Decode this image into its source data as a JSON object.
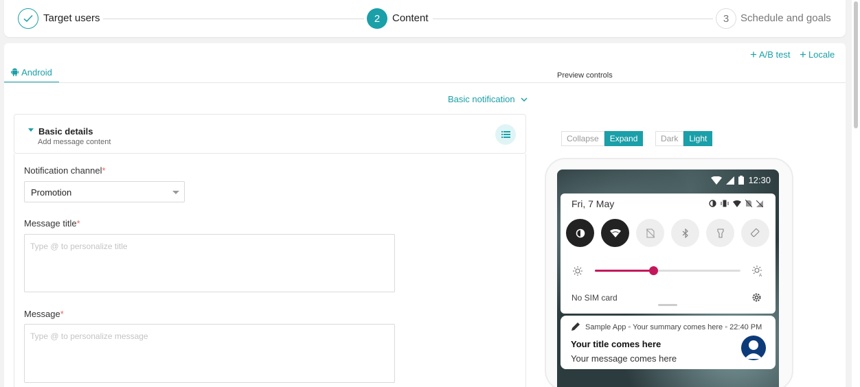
{
  "stepper": {
    "steps": [
      {
        "number": "",
        "label": "Target users",
        "state": "done",
        "icon": "check-icon"
      },
      {
        "number": "2",
        "label": "Content",
        "state": "active"
      },
      {
        "number": "3",
        "label": "Schedule and goals",
        "state": "pending"
      }
    ]
  },
  "header": {
    "ab_test": "A/B test",
    "locale": "Locale",
    "tabs": [
      {
        "label": "Android",
        "icon": "android-icon"
      }
    ]
  },
  "template_dropdown": "Basic notification",
  "basic_details": {
    "title": "Basic details",
    "subtitle": "Add message content"
  },
  "form": {
    "channel_label": "Notification channel",
    "channel_value": "Promotion",
    "title_label": "Message title",
    "title_placeholder": "Type @ to personalize title",
    "message_label": "Message",
    "message_placeholder": "Type @ to personalize message",
    "required_mark": "*"
  },
  "preview": {
    "controls_label": "Preview controls",
    "collapse": "Collapse",
    "expand": "Expand",
    "dark": "Dark",
    "light": "Light",
    "status_time": "12:30",
    "date": "Fri, 7 May",
    "brightness_level": 0.4,
    "no_sim": "No SIM card",
    "notification": {
      "meta": "Sample App ◦ Your summary comes here ◦ 22:40 PM",
      "title": "Your title comes here",
      "message": "Your message comes here"
    }
  },
  "colors": {
    "accent": "#1b9fa8",
    "slider": "#c2185b"
  }
}
